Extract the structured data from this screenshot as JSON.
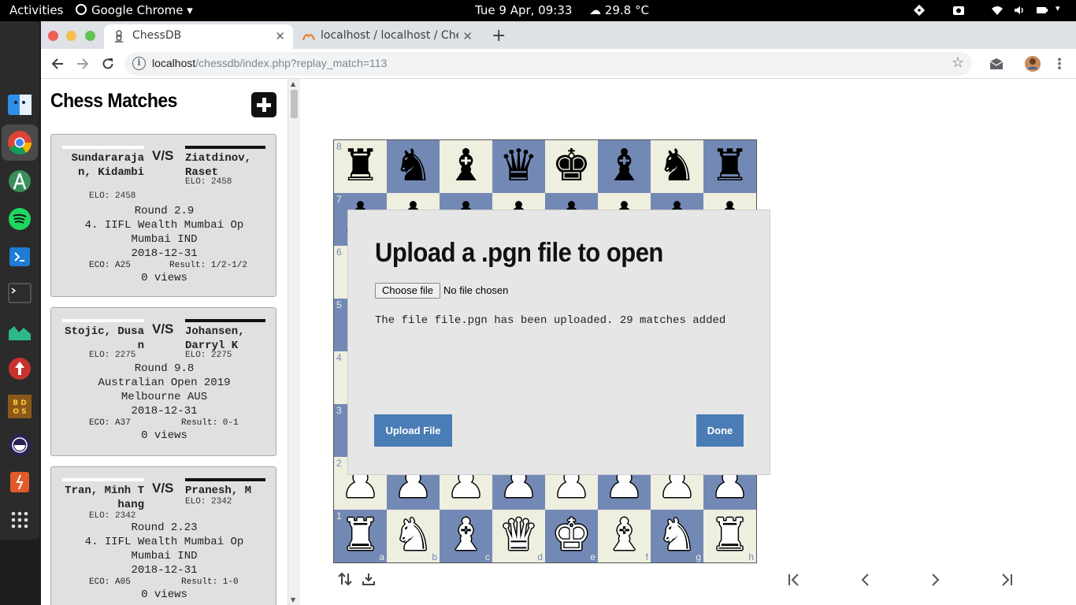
{
  "system": {
    "activities": "Activities",
    "app_name": "Google Chrome",
    "clock": "Tue  9 Apr, 09:33",
    "weather": "29.8 °C"
  },
  "browser": {
    "tabs": [
      {
        "title": "ChessDB",
        "active": true
      },
      {
        "title": "localhost / localhost / Che",
        "active": false
      }
    ],
    "url_host": "localhost",
    "url_path": "/chessdb/index.php?replay_match=113"
  },
  "sidebar": {
    "title": "Chess Matches",
    "matches": [
      {
        "white": "Sundararajan, Kidambi",
        "black": "Ziatdinov, Raset",
        "white_elo": "ELO: 2458",
        "black_elo": "ELO: 2458",
        "vs": "V/S",
        "round": "Round 2.9",
        "event": "4. IIFL Wealth Mumbai Op",
        "site": "Mumbai IND",
        "date": "2018-12-31",
        "eco": "ECO: A25",
        "result": "Result: 1/2-1/2",
        "views": "0 views"
      },
      {
        "white": "Stojic, Dusan",
        "black": "Johansen, Darryl K",
        "white_elo": "ELO: 2275",
        "black_elo": "ELO: 2275",
        "vs": "V/S",
        "round": "Round 9.8",
        "event": "Australian Open 2019",
        "site": "Melbourne AUS",
        "date": "2018-12-31",
        "eco": "ECO: A37",
        "result": "Result: 0-1",
        "views": "0 views"
      },
      {
        "white": "Tran, Minh Thang",
        "black": "Pranesh, M",
        "white_elo": "ELO: 2342",
        "black_elo": "ELO: 2342",
        "vs": "V/S",
        "round": "Round 2.23",
        "event": "4. IIFL Wealth Mumbai Op",
        "site": "Mumbai IND",
        "date": "2018-12-31",
        "eco": "ECO: A05",
        "result": "Result: 1-0",
        "views": "0 views"
      }
    ]
  },
  "board": {
    "ranks": [
      "8",
      "7",
      "6",
      "5",
      "4",
      "3",
      "2",
      "1"
    ],
    "files": [
      "a",
      "b",
      "c",
      "d",
      "e",
      "f",
      "g",
      "h"
    ],
    "position": [
      [
        "bR",
        "bN",
        "bB",
        "bQ",
        "bK",
        "bB",
        "bN",
        "bR"
      ],
      [
        "bP",
        "bP",
        "bP",
        "bP",
        "bP",
        "bP",
        "bP",
        "bP"
      ],
      [
        "",
        "",
        "",
        "",
        "",
        "",
        "",
        ""
      ],
      [
        "",
        "",
        "",
        "",
        "",
        "",
        "",
        ""
      ],
      [
        "",
        "",
        "",
        "",
        "",
        "",
        "",
        ""
      ],
      [
        "",
        "",
        "",
        "",
        "",
        "",
        "",
        ""
      ],
      [
        "wP",
        "wP",
        "wP",
        "wP",
        "wP",
        "wP",
        "wP",
        "wP"
      ],
      [
        "wR",
        "wN",
        "wB",
        "wQ",
        "wK",
        "wB",
        "wN",
        "wR"
      ]
    ],
    "light_color": "#efefdf",
    "dark_color": "#7389b5"
  },
  "modal": {
    "title": "Upload a .pgn file to open",
    "choose_file": "Choose file",
    "file_status": "No file chosen",
    "message": "The file file.pgn has been uploaded. 29 matches added",
    "upload_button": "Upload File",
    "done_button": "Done",
    "button_color": "#4a7cb5"
  }
}
